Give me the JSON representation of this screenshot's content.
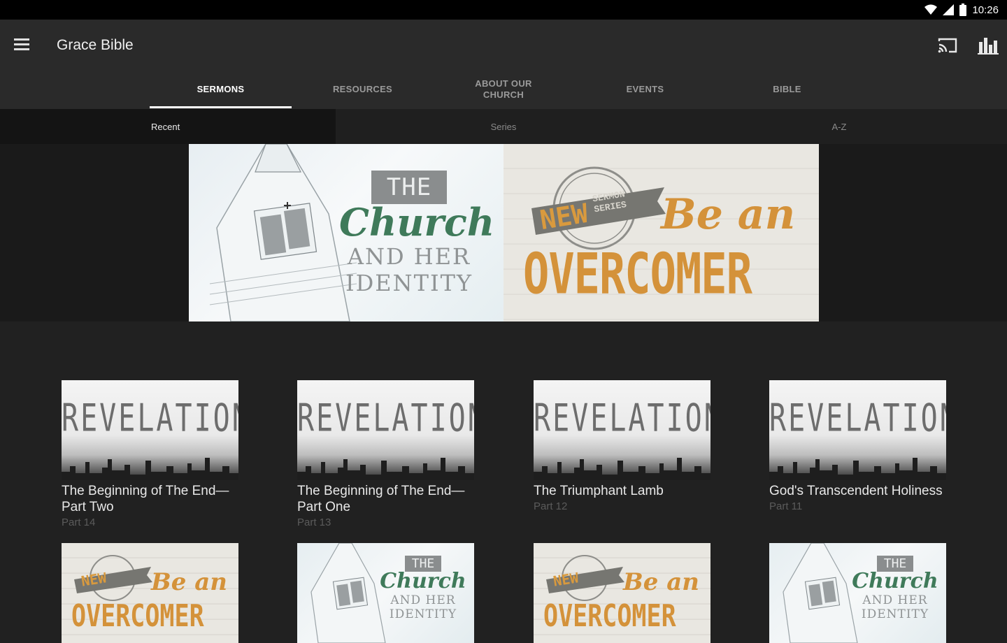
{
  "status": {
    "time": "10:26"
  },
  "app": {
    "title": "Grace Bible"
  },
  "tabs": [
    {
      "label": "SERMONS"
    },
    {
      "label": "RESOURCES"
    },
    {
      "label": "ABOUT OUR CHURCH"
    },
    {
      "label": "EVENTS"
    },
    {
      "label": "BIBLE"
    }
  ],
  "subtabs": [
    {
      "label": "Recent"
    },
    {
      "label": "Series"
    },
    {
      "label": "A-Z"
    }
  ],
  "hero": {
    "left": {
      "the": "THE",
      "church": "Church",
      "and_her": "AND HER",
      "identity": "IDENTITY"
    },
    "right": {
      "new": "NEW",
      "sermon_series": "SERMON SERIES",
      "be_an": "Be an",
      "overcomer": "OVERCOMER"
    }
  },
  "sermons": [
    {
      "artwork": "REVELATION",
      "title": "The Beginning of The End—Part Two",
      "part": "Part 14"
    },
    {
      "artwork": "REVELATION",
      "title": "The Beginning of The End—Part One",
      "part": "Part 13"
    },
    {
      "artwork": "REVELATION",
      "title": "The Triumphant Lamb",
      "part": "Part 12"
    },
    {
      "artwork": "REVELATION",
      "title": "God's Transcendent Holiness",
      "part": "Part 11"
    }
  ],
  "row2": [
    {
      "type": "overcomer",
      "new": "NEW",
      "be_an": "Be an",
      "overcomer": "OVERCOMER"
    },
    {
      "type": "church",
      "the": "THE",
      "church": "Church",
      "and_her": "AND HER",
      "identity": "IDENTITY"
    },
    {
      "type": "overcomer",
      "new": "NEW",
      "be_an": "Be an",
      "overcomer": "OVERCOMER"
    },
    {
      "type": "church",
      "the": "THE",
      "church": "Church",
      "and_her": "AND HER",
      "identity": "IDENTITY"
    }
  ],
  "colors": {
    "background": "#212121",
    "appbar": "#2a2a2a",
    "accent_green": "#3e7a58",
    "accent_orange": "#d4923a",
    "banner_gray": "#8a8a8a"
  },
  "icons": {
    "menu": "menu-icon",
    "cast": "cast-icon",
    "stats": "bar-chart-icon",
    "wifi": "wifi-icon",
    "signal": "signal-icon",
    "battery": "battery-icon"
  }
}
